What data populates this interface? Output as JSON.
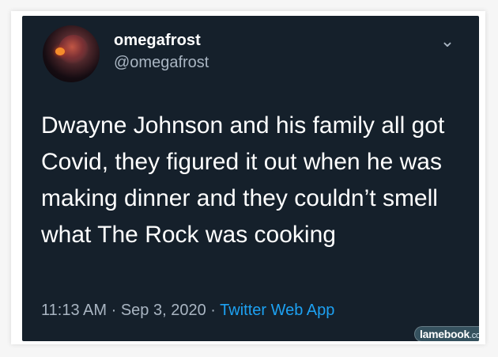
{
  "profile": {
    "display_name": "omegafrost",
    "handle": "@omegafrost"
  },
  "tweet": {
    "text": "Dwayne Johnson and his family all got Covid, they figured it out when he was making dinner and they couldn’t smell what The Rock was cooking",
    "time": "11:13 AM",
    "date_sep": "·",
    "date": "Sep 3, 2020",
    "source_sep": "·",
    "source": "Twitter Web App",
    "menu_icon": "chevron-down-icon"
  },
  "watermark": {
    "brand": "lamebook",
    "domain": ".com"
  },
  "colors": {
    "background": "#15202b",
    "text": "#ffffff",
    "secondary": "#a9b5c2",
    "accent": "#1da1f2"
  }
}
